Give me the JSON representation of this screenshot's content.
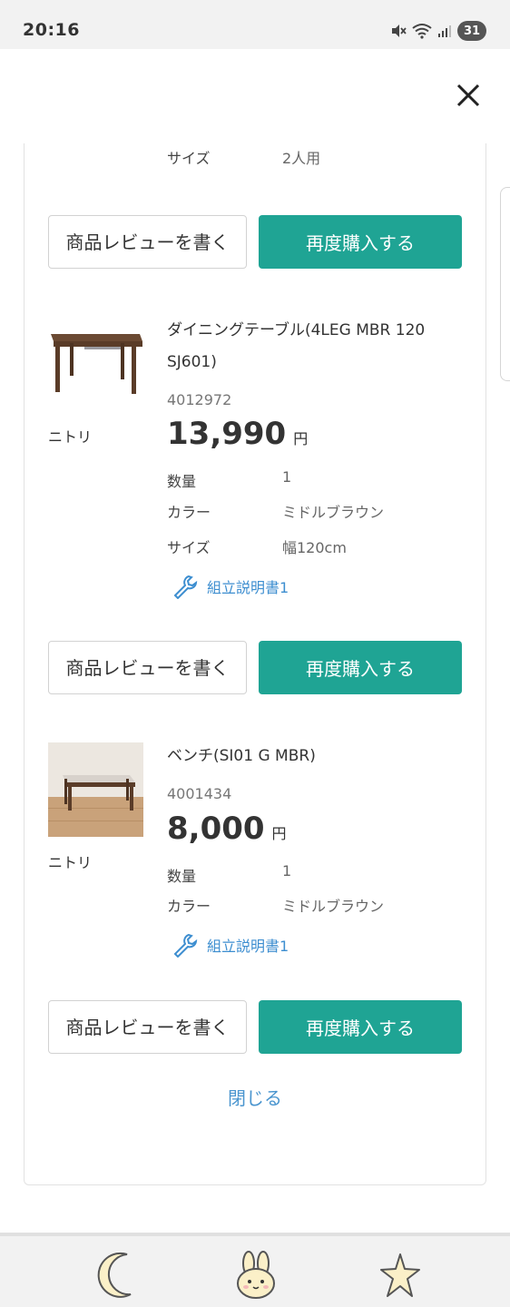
{
  "status_bar": {
    "time": "20:16",
    "battery": "31"
  },
  "top_item": {
    "size_label": "サイズ",
    "size_value": "2人用"
  },
  "buttons": {
    "review": "商品レビューを書く",
    "rebuy": "再度購入する"
  },
  "products": [
    {
      "name": "ダイニングテーブル(4LEG MBR 120 SJ601)",
      "code": "4012972",
      "maker": "ニトリ",
      "price": "13,990",
      "currency": "円",
      "specs": [
        {
          "label": "数量",
          "value": "1"
        },
        {
          "label": "カラー",
          "value": "ミドルブラウン"
        },
        {
          "label": "サイズ",
          "value": "幅120cm"
        }
      ],
      "manual": "組立説明書1"
    },
    {
      "name": "ベンチ(SI01 G MBR)",
      "code": "4001434",
      "maker": "ニトリ",
      "price": "8,000",
      "currency": "円",
      "specs": [
        {
          "label": "数量",
          "value": "1"
        },
        {
          "label": "カラー",
          "value": "ミドルブラウン"
        }
      ],
      "manual": "組立説明書1"
    }
  ],
  "close_link": "閉じる",
  "colors": {
    "accent": "#1fa494",
    "link": "#3d8ed0"
  },
  "bottom_nav": [
    "moon-icon",
    "bunny-icon",
    "star-icon"
  ]
}
